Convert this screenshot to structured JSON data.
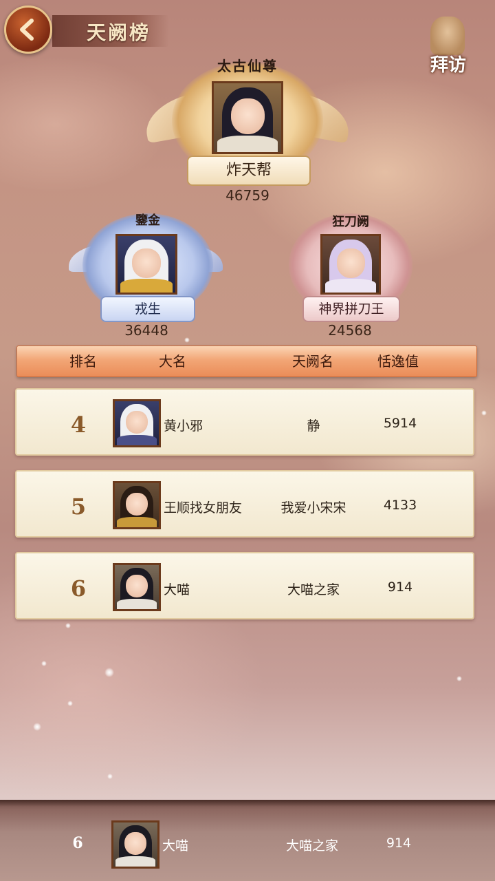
{
  "header": {
    "title": "天阙榜",
    "visit_label": "拜访"
  },
  "podium": [
    {
      "rank": 1,
      "title": "太古仙尊",
      "name": "炸天帮",
      "score": "46759"
    },
    {
      "rank": 2,
      "title": "鑒金",
      "name": "戎生",
      "score": "36448"
    },
    {
      "rank": 3,
      "title": "狂刀阙",
      "name": "神界拼刀王",
      "score": "24568"
    }
  ],
  "table": {
    "columns": [
      "排名",
      "大名",
      "天阙名",
      "恬逸值"
    ],
    "rows": [
      {
        "rank": "4",
        "name": "黄小邪",
        "que_name": "静",
        "value": "5914"
      },
      {
        "rank": "5",
        "name": "王顺找女朋友",
        "que_name": "我爱小宋宋",
        "value": "4133"
      },
      {
        "rank": "6",
        "name": "大喵",
        "que_name": "大喵之家",
        "value": "914"
      }
    ]
  },
  "my_rank": {
    "rank": "6",
    "name": "大喵",
    "que_name": "大喵之家",
    "value": "914"
  },
  "colors": {
    "header_bar": "#ea8c58",
    "row_bg": "#fbf6e8",
    "rank_num": "#8a5a2a",
    "back_button": "#c9622f"
  }
}
